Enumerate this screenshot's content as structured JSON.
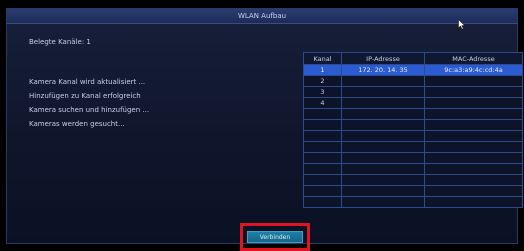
{
  "dialog": {
    "title": "WLAN Aufbau"
  },
  "occupied_channels": "Belegte Kanäle: 1",
  "status_lines": [
    "Kamera Kanal wird aktualisiert ...",
    "Hinzufügen zu Kanal erfolgreich",
    "Kamera suchen und hinzufügen ...",
    "Kameras werden gesucht..."
  ],
  "table": {
    "headers": [
      "Kanal",
      "IP-Adresse",
      "MAC-Adresse"
    ],
    "rows": [
      {
        "kanal": "1",
        "ip": "172. 20. 14. 35",
        "mac": "9c:a3:a9:4c:cd:4a",
        "selected": true
      },
      {
        "kanal": "2",
        "ip": "",
        "mac": ""
      },
      {
        "kanal": "3",
        "ip": "",
        "mac": ""
      },
      {
        "kanal": "4",
        "ip": "",
        "mac": ""
      },
      {
        "kanal": "",
        "ip": "",
        "mac": ""
      },
      {
        "kanal": "",
        "ip": "",
        "mac": ""
      },
      {
        "kanal": "",
        "ip": "",
        "mac": ""
      },
      {
        "kanal": "",
        "ip": "",
        "mac": ""
      },
      {
        "kanal": "",
        "ip": "",
        "mac": ""
      },
      {
        "kanal": "",
        "ip": "",
        "mac": ""
      },
      {
        "kanal": "",
        "ip": "",
        "mac": ""
      },
      {
        "kanal": "",
        "ip": "",
        "mac": ""
      },
      {
        "kanal": "",
        "ip": "",
        "mac": ""
      }
    ]
  },
  "button": {
    "label": "Verbinden"
  },
  "colors": {
    "selected_row": "#2a5bd2",
    "button": "#1f7fa8",
    "highlight_frame": "#e0141e"
  }
}
